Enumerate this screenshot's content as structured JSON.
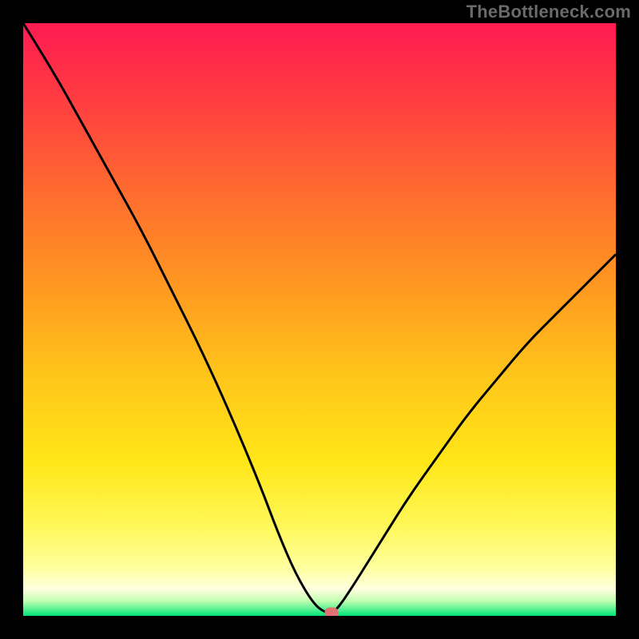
{
  "watermark": "TheBottleneck.com",
  "colors": {
    "frame": "#000000",
    "curve": "#000000",
    "marker": "#e27272",
    "gradient_stops": [
      {
        "offset": 0.0,
        "color": "#ff1a52"
      },
      {
        "offset": 0.12,
        "color": "#ff3a42"
      },
      {
        "offset": 0.28,
        "color": "#ff6a2f"
      },
      {
        "offset": 0.45,
        "color": "#ff9a20"
      },
      {
        "offset": 0.6,
        "color": "#ffc71a"
      },
      {
        "offset": 0.74,
        "color": "#ffe617"
      },
      {
        "offset": 0.85,
        "color": "#fff85a"
      },
      {
        "offset": 0.92,
        "color": "#ffffa0"
      },
      {
        "offset": 0.955,
        "color": "#ffffe0"
      },
      {
        "offset": 0.975,
        "color": "#c0ffb0"
      },
      {
        "offset": 0.99,
        "color": "#4ef08f"
      },
      {
        "offset": 1.0,
        "color": "#00e47a"
      }
    ]
  },
  "chart_data": {
    "type": "line",
    "title": "",
    "xlabel": "",
    "ylabel": "",
    "xlim": [
      0,
      100
    ],
    "ylim": [
      0,
      100
    ],
    "grid": false,
    "series": [
      {
        "name": "bottleneck-curve",
        "x": [
          0,
          5,
          10,
          15,
          20,
          25,
          30,
          35,
          40,
          43,
          46,
          49,
          51,
          52.5,
          55,
          60,
          65,
          70,
          75,
          80,
          85,
          90,
          95,
          100
        ],
        "y": [
          100,
          92,
          83,
          74,
          65,
          55,
          45,
          34,
          22,
          14,
          7,
          2,
          0.5,
          0.5,
          4,
          12,
          20,
          27,
          34,
          40,
          46,
          51,
          56,
          61
        ]
      }
    ],
    "min_marker": {
      "x": 52,
      "y": 0.5
    }
  }
}
